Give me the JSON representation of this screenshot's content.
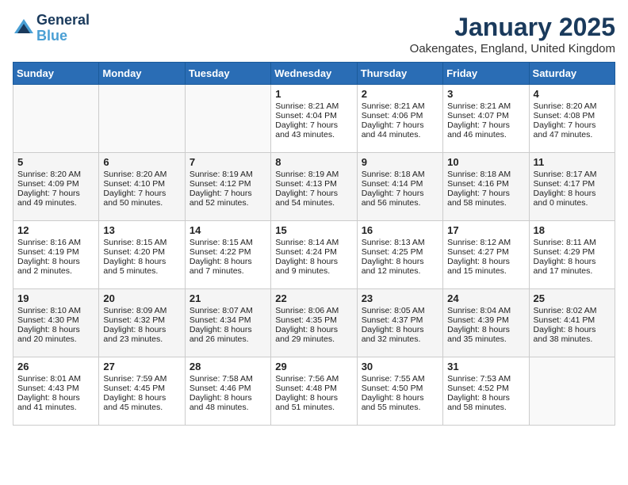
{
  "header": {
    "logo_line1": "General",
    "logo_line2": "Blue",
    "title": "January 2025",
    "subtitle": "Oakengates, England, United Kingdom"
  },
  "days_of_week": [
    "Sunday",
    "Monday",
    "Tuesday",
    "Wednesday",
    "Thursday",
    "Friday",
    "Saturday"
  ],
  "weeks": [
    [
      {
        "day": null,
        "data": null
      },
      {
        "day": null,
        "data": null
      },
      {
        "day": null,
        "data": null
      },
      {
        "day": "1",
        "data": {
          "sunrise": "8:21 AM",
          "sunset": "4:04 PM",
          "daylight": "7 hours and 43 minutes."
        }
      },
      {
        "day": "2",
        "data": {
          "sunrise": "8:21 AM",
          "sunset": "4:06 PM",
          "daylight": "7 hours and 44 minutes."
        }
      },
      {
        "day": "3",
        "data": {
          "sunrise": "8:21 AM",
          "sunset": "4:07 PM",
          "daylight": "7 hours and 46 minutes."
        }
      },
      {
        "day": "4",
        "data": {
          "sunrise": "8:20 AM",
          "sunset": "4:08 PM",
          "daylight": "7 hours and 47 minutes."
        }
      }
    ],
    [
      {
        "day": "5",
        "data": {
          "sunrise": "8:20 AM",
          "sunset": "4:09 PM",
          "daylight": "7 hours and 49 minutes."
        }
      },
      {
        "day": "6",
        "data": {
          "sunrise": "8:20 AM",
          "sunset": "4:10 PM",
          "daylight": "7 hours and 50 minutes."
        }
      },
      {
        "day": "7",
        "data": {
          "sunrise": "8:19 AM",
          "sunset": "4:12 PM",
          "daylight": "7 hours and 52 minutes."
        }
      },
      {
        "day": "8",
        "data": {
          "sunrise": "8:19 AM",
          "sunset": "4:13 PM",
          "daylight": "7 hours and 54 minutes."
        }
      },
      {
        "day": "9",
        "data": {
          "sunrise": "8:18 AM",
          "sunset": "4:14 PM",
          "daylight": "7 hours and 56 minutes."
        }
      },
      {
        "day": "10",
        "data": {
          "sunrise": "8:18 AM",
          "sunset": "4:16 PM",
          "daylight": "7 hours and 58 minutes."
        }
      },
      {
        "day": "11",
        "data": {
          "sunrise": "8:17 AM",
          "sunset": "4:17 PM",
          "daylight": "8 hours and 0 minutes."
        }
      }
    ],
    [
      {
        "day": "12",
        "data": {
          "sunrise": "8:16 AM",
          "sunset": "4:19 PM",
          "daylight": "8 hours and 2 minutes."
        }
      },
      {
        "day": "13",
        "data": {
          "sunrise": "8:15 AM",
          "sunset": "4:20 PM",
          "daylight": "8 hours and 5 minutes."
        }
      },
      {
        "day": "14",
        "data": {
          "sunrise": "8:15 AM",
          "sunset": "4:22 PM",
          "daylight": "8 hours and 7 minutes."
        }
      },
      {
        "day": "15",
        "data": {
          "sunrise": "8:14 AM",
          "sunset": "4:24 PM",
          "daylight": "8 hours and 9 minutes."
        }
      },
      {
        "day": "16",
        "data": {
          "sunrise": "8:13 AM",
          "sunset": "4:25 PM",
          "daylight": "8 hours and 12 minutes."
        }
      },
      {
        "day": "17",
        "data": {
          "sunrise": "8:12 AM",
          "sunset": "4:27 PM",
          "daylight": "8 hours and 15 minutes."
        }
      },
      {
        "day": "18",
        "data": {
          "sunrise": "8:11 AM",
          "sunset": "4:29 PM",
          "daylight": "8 hours and 17 minutes."
        }
      }
    ],
    [
      {
        "day": "19",
        "data": {
          "sunrise": "8:10 AM",
          "sunset": "4:30 PM",
          "daylight": "8 hours and 20 minutes."
        }
      },
      {
        "day": "20",
        "data": {
          "sunrise": "8:09 AM",
          "sunset": "4:32 PM",
          "daylight": "8 hours and 23 minutes."
        }
      },
      {
        "day": "21",
        "data": {
          "sunrise": "8:07 AM",
          "sunset": "4:34 PM",
          "daylight": "8 hours and 26 minutes."
        }
      },
      {
        "day": "22",
        "data": {
          "sunrise": "8:06 AM",
          "sunset": "4:35 PM",
          "daylight": "8 hours and 29 minutes."
        }
      },
      {
        "day": "23",
        "data": {
          "sunrise": "8:05 AM",
          "sunset": "4:37 PM",
          "daylight": "8 hours and 32 minutes."
        }
      },
      {
        "day": "24",
        "data": {
          "sunrise": "8:04 AM",
          "sunset": "4:39 PM",
          "daylight": "8 hours and 35 minutes."
        }
      },
      {
        "day": "25",
        "data": {
          "sunrise": "8:02 AM",
          "sunset": "4:41 PM",
          "daylight": "8 hours and 38 minutes."
        }
      }
    ],
    [
      {
        "day": "26",
        "data": {
          "sunrise": "8:01 AM",
          "sunset": "4:43 PM",
          "daylight": "8 hours and 41 minutes."
        }
      },
      {
        "day": "27",
        "data": {
          "sunrise": "7:59 AM",
          "sunset": "4:45 PM",
          "daylight": "8 hours and 45 minutes."
        }
      },
      {
        "day": "28",
        "data": {
          "sunrise": "7:58 AM",
          "sunset": "4:46 PM",
          "daylight": "8 hours and 48 minutes."
        }
      },
      {
        "day": "29",
        "data": {
          "sunrise": "7:56 AM",
          "sunset": "4:48 PM",
          "daylight": "8 hours and 51 minutes."
        }
      },
      {
        "day": "30",
        "data": {
          "sunrise": "7:55 AM",
          "sunset": "4:50 PM",
          "daylight": "8 hours and 55 minutes."
        }
      },
      {
        "day": "31",
        "data": {
          "sunrise": "7:53 AM",
          "sunset": "4:52 PM",
          "daylight": "8 hours and 58 minutes."
        }
      },
      {
        "day": null,
        "data": null
      }
    ]
  ],
  "labels": {
    "sunrise": "Sunrise:",
    "sunset": "Sunset:",
    "daylight": "Daylight:"
  }
}
